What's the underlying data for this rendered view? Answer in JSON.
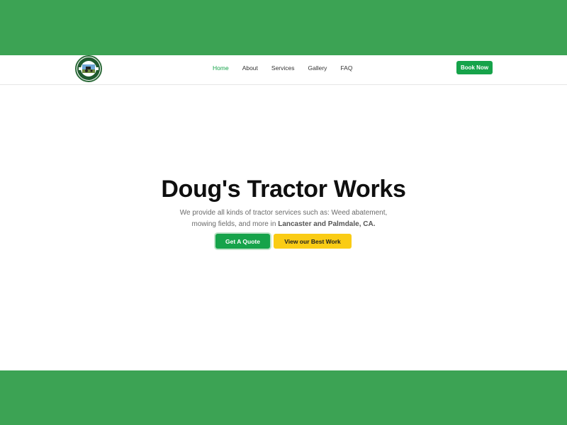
{
  "header": {
    "logo_icon": "tractor-badge-logo"
  },
  "nav": {
    "items": [
      {
        "label": "Home",
        "active": true
      },
      {
        "label": "About",
        "active": false
      },
      {
        "label": "Services",
        "active": false
      },
      {
        "label": "Gallery",
        "active": false
      },
      {
        "label": "FAQ",
        "active": false
      }
    ],
    "book_label": "Book Now"
  },
  "hero": {
    "title": "Doug's Tractor Works",
    "description_plain": "We provide all kinds of tractor services such as: Weed abatement, mowing fields, and more in",
    "description_bold": "Lancaster and Palmdale, CA.",
    "quote_label": "Get A Quote",
    "work_label": "View our Best Work"
  },
  "colors": {
    "brand_green": "#16a34a",
    "band_green": "#3ca354",
    "accent_yellow": "#facc15"
  }
}
